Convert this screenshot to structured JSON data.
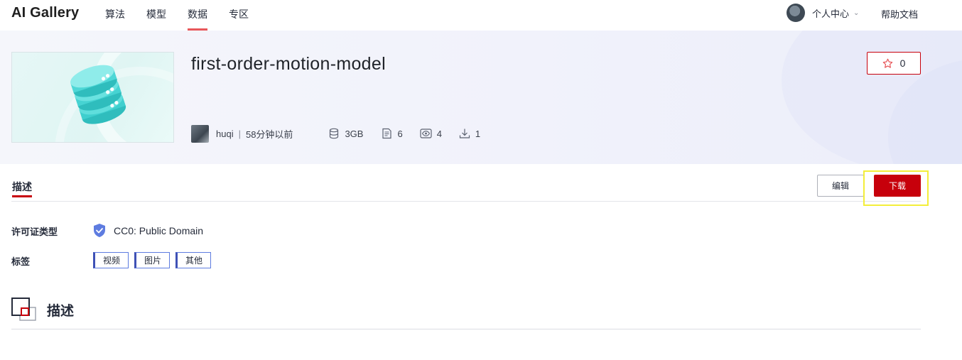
{
  "brand": "AI Gallery",
  "nav": {
    "items": [
      "算法",
      "模型",
      "数据",
      "专区"
    ],
    "active_index": 2
  },
  "user_menu": {
    "label": "个人中心",
    "chevron": "chevron-down-icon"
  },
  "help": "帮助文档",
  "dataset": {
    "title": "first-order-motion-model",
    "author": "huqi",
    "separator": "|",
    "time": "58分钟以前",
    "size": "3GB",
    "files": "6",
    "views": "4",
    "downloads": "1",
    "favorites": "0"
  },
  "tabs": {
    "description": "描述"
  },
  "actions": {
    "edit": "编辑",
    "download": "下载"
  },
  "info": {
    "license_label": "许可证类型",
    "license_value": "CC0: Public Domain",
    "tags_label": "标签",
    "tags": [
      "视频",
      "图片",
      "其他"
    ]
  },
  "section": {
    "title": "描述"
  },
  "colors": {
    "accent_red": "#c7000b",
    "nav_active_underline": "#e8575a",
    "highlight_box": "#f3ee3a",
    "tag_border": "#5e7ce0",
    "shield_blue": "#5e7ce0"
  }
}
